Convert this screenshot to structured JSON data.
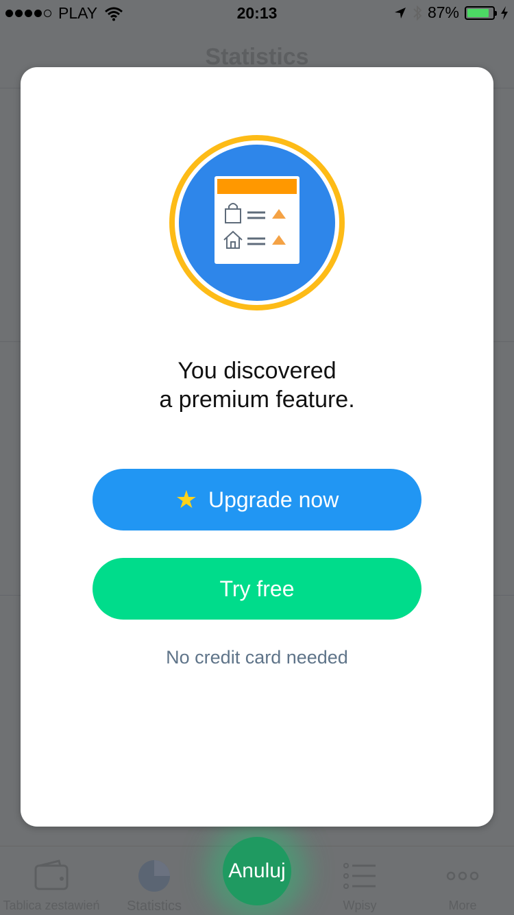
{
  "status_bar": {
    "carrier": "PLAY",
    "time": "20:13",
    "battery_percent": "87%",
    "signal_bars_filled": 4,
    "signal_bars_total": 5,
    "battery_level": 0.87,
    "battery_color": "#4cd964"
  },
  "background_screen": {
    "title": "Statistics"
  },
  "tab_bar": {
    "tabs": [
      {
        "label": "Tablica zestawień",
        "icon": "wallet-icon"
      },
      {
        "label": "Statistics",
        "icon": "pie-chart-icon"
      },
      {
        "label": "Wpisy",
        "icon": "list-icon"
      },
      {
        "label": "More",
        "icon": "more-dots-icon"
      }
    ],
    "cancel_label": "Anuluj"
  },
  "modal": {
    "illustration_icon": "premium-feature-report-icon",
    "headline_line1": "You discovered",
    "headline_line2": "a premium feature.",
    "upgrade_label": "Upgrade now",
    "try_label": "Try free",
    "note": "No credit card needed"
  },
  "colors": {
    "upgrade_button": "#2196f3",
    "try_button": "#00dc8b",
    "star": "#ffd21a",
    "illustration_ring": "#fdbb17",
    "illustration_circle": "#2e86ea",
    "illustration_header": "#ff9800"
  }
}
